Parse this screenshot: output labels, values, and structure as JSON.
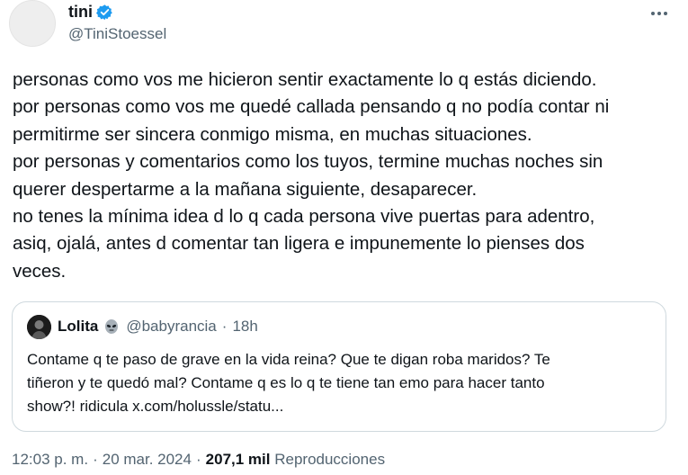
{
  "author": {
    "display_name": "tini",
    "handle": "@TiniStoessel",
    "verified_icon": "verified-badge-icon",
    "verified_color": "#1d9bf0"
  },
  "more_icon": "more-options-icon",
  "tweet_lines": [
    "personas como vos me hicieron sentir exactamente lo q estás diciendo.",
    "por personas como vos me quedé callada pensando q no podía contar ni",
    "permitirme ser sincera conmigo misma, en muchas situaciones.",
    "por personas y comentarios como los tuyos, termine muchas noches sin",
    "querer despertarme a la mañana siguiente, desaparecer.",
    "no tenes la mínima idea d lo q cada persona vive puertas para adentro,",
    "asiq, ojalá, antes d comentar tan ligera e impunemente lo pienses dos",
    "veces."
  ],
  "quoted": {
    "display_name": "Lolita",
    "emoji_icon": "alien-emoji-icon",
    "handle": "@babyrancia",
    "separator": "·",
    "time": "18h",
    "lines": [
      "Contame q te paso de grave en la vida reina? Que te digan roba maridos? Te",
      "tiñeron y te quedó mal? Contame q es lo q te tiene tan emo para hacer tanto",
      "show?! ridicula x.com/holussle/statu..."
    ]
  },
  "footer": {
    "time": "12:03 p. m.",
    "sep1": "·",
    "date": "20 mar. 2024",
    "sep2": "·",
    "views_count": "207,1 mil",
    "views_label": "Reproducciones"
  },
  "colors": {
    "text": "#0f1419",
    "secondary": "#536471",
    "border": "#cfd9de"
  }
}
